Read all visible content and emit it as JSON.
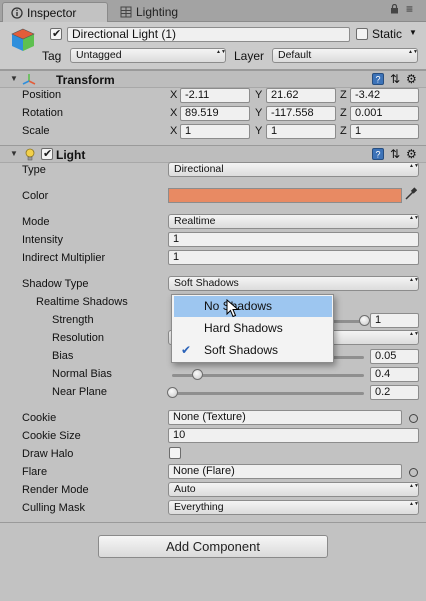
{
  "tabs": {
    "inspector": "Inspector",
    "lighting": "Lighting"
  },
  "header": {
    "object_name": "Directional Light (1)",
    "static_label": "Static",
    "tag_label": "Tag",
    "tag_value": "Untagged",
    "layer_label": "Layer",
    "layer_value": "Default"
  },
  "transform": {
    "title": "Transform",
    "rows": [
      {
        "label": "Position",
        "x": "-2.11",
        "y": "21.62",
        "z": "-3.42"
      },
      {
        "label": "Rotation",
        "x": "89.519",
        "y": "-117.558",
        "z": "0.001"
      },
      {
        "label": "Scale",
        "x": "1",
        "y": "1",
        "z": "1"
      }
    ],
    "axis": {
      "x": "X",
      "y": "Y",
      "z": "Z"
    }
  },
  "light": {
    "title": "Light",
    "type_label": "Type",
    "type_value": "Directional",
    "color_label": "Color",
    "color_hex": "#e88a63",
    "mode_label": "Mode",
    "mode_value": "Realtime",
    "intensity_label": "Intensity",
    "intensity_value": "1",
    "indirect_label": "Indirect Multiplier",
    "indirect_value": "1",
    "shadow_type_label": "Shadow Type",
    "shadow_type_value": "Soft Shadows",
    "realtime_shadows_label": "Realtime Shadows",
    "strength_label": "Strength",
    "strength_value": "1",
    "strength_fraction": 1.0,
    "resolution_label": "Resolution",
    "bias_label": "Bias",
    "bias_value": "0.05",
    "bias_fraction": 0.025,
    "normal_bias_label": "Normal Bias",
    "normal_bias_value": "0.4",
    "normal_bias_fraction": 0.13,
    "near_plane_label": "Near Plane",
    "near_plane_value": "0.2",
    "near_plane_fraction": 0.0,
    "cookie_label": "Cookie",
    "cookie_value": "None (Texture)",
    "cookie_size_label": "Cookie Size",
    "cookie_size_value": "10",
    "draw_halo_label": "Draw Halo",
    "flare_label": "Flare",
    "flare_value": "None (Flare)",
    "render_mode_label": "Render Mode",
    "render_mode_value": "Auto",
    "culling_mask_label": "Culling Mask",
    "culling_mask_value": "Everything"
  },
  "shadow_popup": {
    "items": [
      {
        "label": "No Shadows",
        "highlighted": true,
        "checked": false
      },
      {
        "label": "Hard Shadows",
        "highlighted": false,
        "checked": false
      },
      {
        "label": "Soft Shadows",
        "highlighted": false,
        "checked": true
      }
    ]
  },
  "add_component": "Add Component",
  "colors": {
    "selection": "#9dc6f0",
    "panel": "#c2c2c2",
    "light_color": "#e88a63"
  }
}
